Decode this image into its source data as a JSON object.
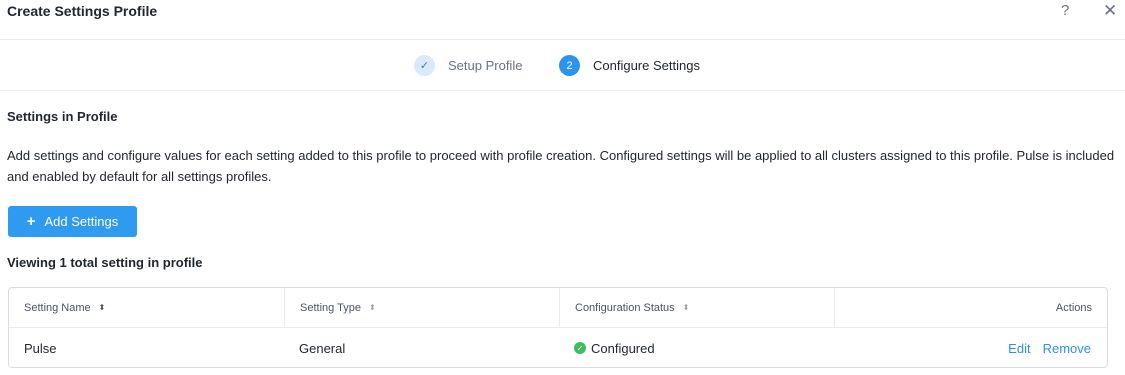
{
  "header": {
    "title": "Create Settings Profile",
    "help_icon": "?",
    "close_icon": "✕"
  },
  "steps": [
    {
      "number": "✓",
      "label": "Setup Profile",
      "state": "completed"
    },
    {
      "number": "2",
      "label": "Configure Settings",
      "state": "active"
    }
  ],
  "section": {
    "title": "Settings in Profile",
    "description": "Add settings and configure values for each setting added to this profile to proceed with profile creation. Configured settings will be applied to all clusters assigned to this profile. Pulse is included and enabled by default for all settings profiles."
  },
  "add_button": {
    "icon": "+",
    "label": "Add Settings"
  },
  "viewing_text": "Viewing 1 total setting in profile",
  "table": {
    "columns": [
      {
        "label": "Setting Name",
        "sort_icon": "⬍"
      },
      {
        "label": "Setting Type",
        "sort_icon": "⬍"
      },
      {
        "label": "Configuration Status",
        "sort_icon": "⬍"
      },
      {
        "label": "Actions"
      }
    ],
    "rows": [
      {
        "name": "Pulse",
        "type": "General",
        "status": "Configured",
        "status_icon": "✓",
        "actions": [
          "Edit",
          "Remove"
        ]
      }
    ]
  },
  "colors": {
    "primary": "#2e9af0",
    "link": "#2e8fe6",
    "success": "#3bbf5e",
    "step_completed_bg": "#dbeafa"
  }
}
